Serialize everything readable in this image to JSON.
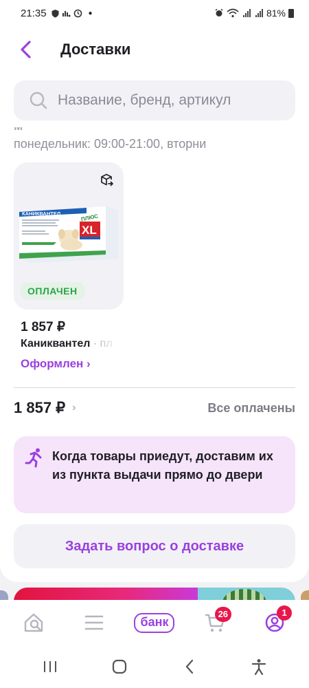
{
  "status_bar": {
    "time": "21:35",
    "battery": "81%",
    "icons": [
      "shield-icon",
      "wifi-signal-icon",
      "clock-icon",
      "dot-icon",
      "alarm-icon",
      "wifi-icon",
      "signal-icon",
      "signal-icon",
      "battery-icon"
    ]
  },
  "header": {
    "title": "Доставки",
    "back_icon": "chevron-left-icon"
  },
  "search": {
    "placeholder": "Название, бренд, артикул",
    "value": ""
  },
  "pickup_point": {
    "hours": "понедельник: 09:00-21:00, вторни"
  },
  "product": {
    "image_title": "КАНИКВАНТЕЛ",
    "image_sub": "ПЛЮС",
    "image_size": "XL",
    "paid_badge": "ОПЛАЧЕН",
    "price": "1 857 ₽",
    "name": "Каниквантел",
    "name_suffix": " · пл",
    "status": "Оформлен ›"
  },
  "summary": {
    "total": "1 857 ₽",
    "chevron": "›",
    "payment_status": "Все оплачены"
  },
  "info": {
    "text": "Когда товары приедут, доставим их из пункта выдачи прямо до двери",
    "icon": "running-person-icon"
  },
  "actions": {
    "ask_delivery": "Задать вопрос о доставке"
  },
  "tabbar": {
    "bank_label": "банк",
    "cart_badge": "26",
    "profile_badge": "1"
  },
  "colors": {
    "accent": "#9b3fe0",
    "paid_green": "#2aa44a",
    "badge_red": "#e8174b",
    "info_bg": "#f6e4fb"
  }
}
